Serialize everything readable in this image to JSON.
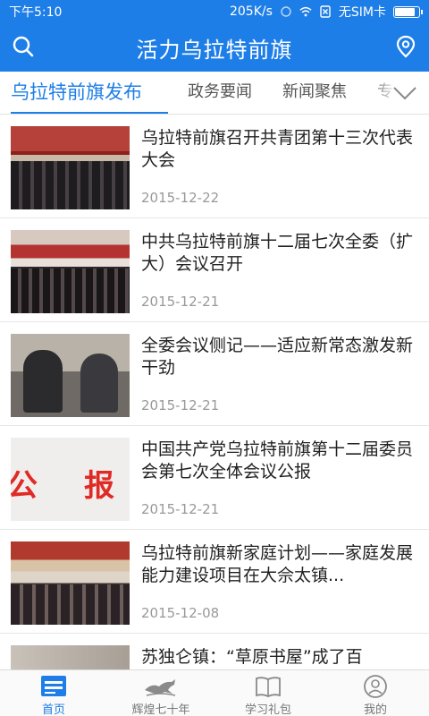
{
  "status_bar": {
    "time": "下午5:10",
    "speed": "205K/s",
    "sim": "无SIM卡"
  },
  "header": {
    "title": "活力乌拉特前旗",
    "search_icon": "search-icon",
    "location_icon": "location-pin-icon"
  },
  "tabs": [
    {
      "label": "乌拉特前旗发布",
      "active": true
    },
    {
      "label": "政务要闻",
      "active": false
    },
    {
      "label": "新闻聚焦",
      "active": false
    },
    {
      "label": "专",
      "active": false
    }
  ],
  "news": [
    {
      "title": "乌拉特前旗召开共青团第十三次代表大会",
      "date": "2015-12-22"
    },
    {
      "title": "中共乌拉特前旗十二届七次全委（扩大）会议召开",
      "date": "2015-12-21"
    },
    {
      "title": "全委会议侧记——适应新常态激发新干劲",
      "date": "2015-12-21"
    },
    {
      "title": "中国共产党乌拉特前旗第十二届委员会第七次全体会议公报",
      "date": "2015-12-21",
      "thumb_text": [
        "公",
        "报"
      ]
    },
    {
      "title": "乌拉特前旗新家庭计划——家庭发展能力建设项目在大佘太镇...",
      "date": "2015-12-08"
    },
    {
      "title": "苏独仑镇：“草原书屋”成了百",
      "date": ""
    }
  ],
  "bottom_nav": [
    {
      "label": "首页",
      "icon": "news-home-icon",
      "active": true
    },
    {
      "label": "辉煌七十年",
      "icon": "horse-emblem-icon",
      "active": false
    },
    {
      "label": "学习礼包",
      "icon": "open-book-icon",
      "active": false
    },
    {
      "label": "我的",
      "icon": "user-profile-icon",
      "active": false
    }
  ],
  "colors": {
    "brand_blue": "#1e7ee8",
    "text_dark": "#222222",
    "text_muted": "#999999"
  }
}
